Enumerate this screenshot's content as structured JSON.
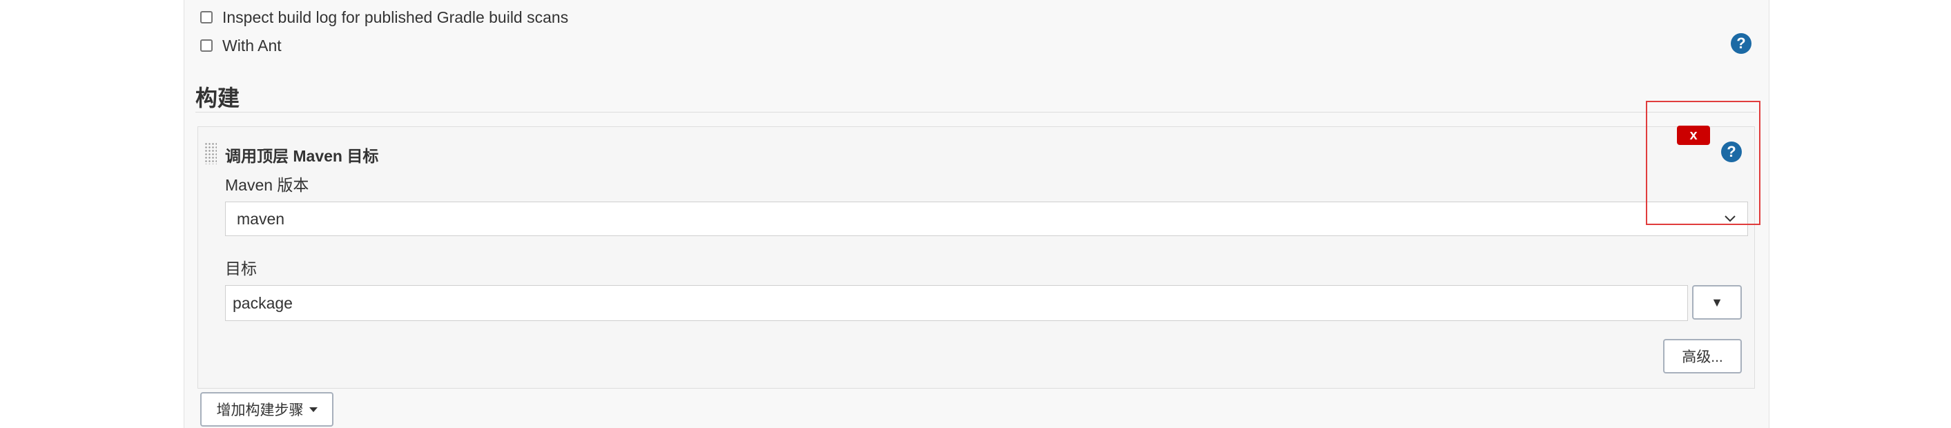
{
  "checkboxes": [
    {
      "label": "Inspect build log for published Gradle build scans",
      "checked": false
    },
    {
      "label": "With Ant",
      "checked": false
    }
  ],
  "help": {
    "symbol": "?"
  },
  "build_section": {
    "title": "构建"
  },
  "build_step": {
    "title": "调用顶层 Maven 目标",
    "delete_label": "x",
    "maven_version": {
      "label": "Maven 版本",
      "selected": "maven"
    },
    "goals": {
      "label": "目标",
      "value": "package",
      "expand_symbol": "▼"
    },
    "advanced_label": "高级..."
  },
  "add_step_label": "增加构建步骤",
  "colors": {
    "help_icon": "#1c6aa5",
    "delete_button": "#cc0000",
    "highlight": "#e03c3c",
    "panel_background": "#f8f8f8"
  }
}
